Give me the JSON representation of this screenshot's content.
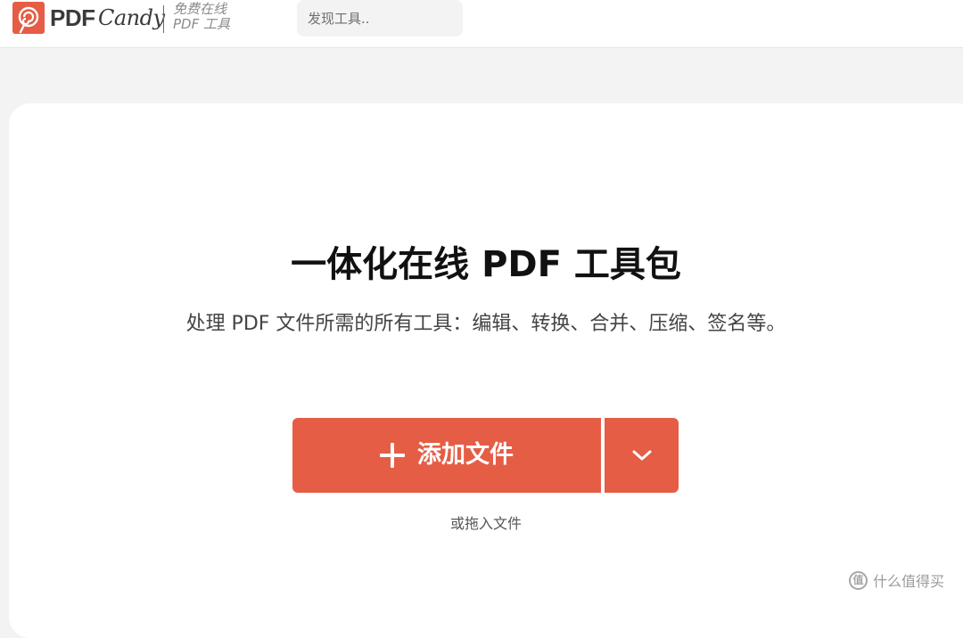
{
  "header": {
    "logo": {
      "name_pdf": "PDF",
      "name_candy": "Candy",
      "tagline_line1": "免费在线",
      "tagline_line2": "PDF 工具"
    },
    "search": {
      "placeholder": "发现工具.."
    }
  },
  "hero": {
    "title": "一体化在线 PDF 工具包",
    "subtitle": "处理 PDF 文件所需的所有工具：编辑、转换、合并、压缩、签名等。"
  },
  "upload": {
    "add_label": "添加文件",
    "drop_hint": "或拖入文件"
  },
  "watermark": {
    "badge": "值",
    "text": "什么值得买"
  },
  "colors": {
    "brand": "#e55d45",
    "background": "#f3f3f3",
    "card": "#ffffff"
  },
  "icons": {
    "logo": "lollipop-spiral-icon",
    "add": "plus-icon",
    "dropdown": "chevron-down-icon"
  }
}
